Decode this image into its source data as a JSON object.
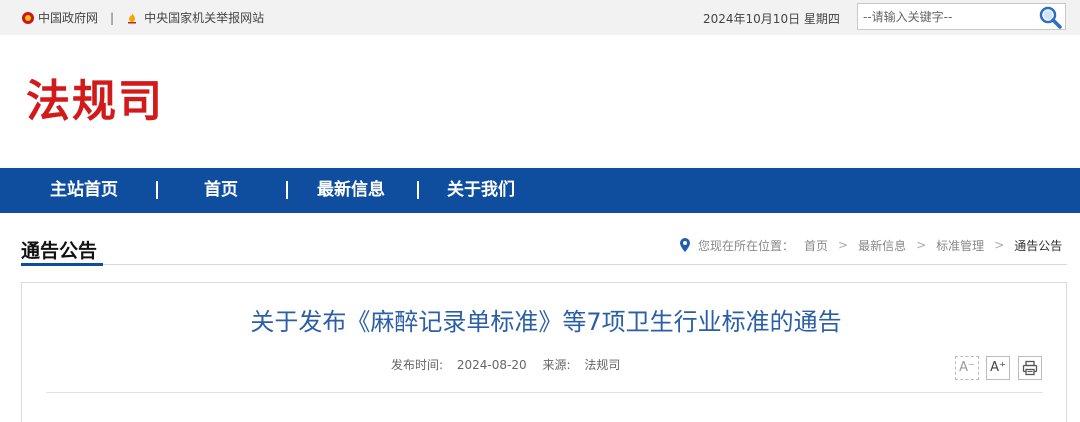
{
  "topbar": {
    "gov_link": "中国政府网",
    "separator": "|",
    "report_link": "中央国家机关举报网站",
    "date": "2024年10月10日  星期四",
    "search_placeholder": "--请输入关键字--"
  },
  "header": {
    "logo_text": "法规司"
  },
  "nav": {
    "items": [
      {
        "label": "主站首页"
      },
      {
        "label": "首页"
      },
      {
        "label": "最新信息"
      },
      {
        "label": "关于我们"
      }
    ],
    "divider": "|"
  },
  "section": {
    "title": "通告公告",
    "breadcrumb_prefix": "您现在所在位置：",
    "breadcrumb": [
      "首页",
      "最新信息",
      "标准管理",
      "通告公告"
    ],
    "arrow": ">"
  },
  "article": {
    "title": "关于发布《麻醉记录单标准》等7项卫生行业标准的通告",
    "publish_label": "发布时间:",
    "publish_date": "2024-08-20",
    "source_label": "来源:",
    "source": "法规司",
    "font_smaller": "A⁻",
    "font_larger": "A⁺"
  },
  "colors": {
    "nav_bg": "#0f4e9e",
    "logo": "#d21a1a",
    "title": "#2a5fa8"
  }
}
